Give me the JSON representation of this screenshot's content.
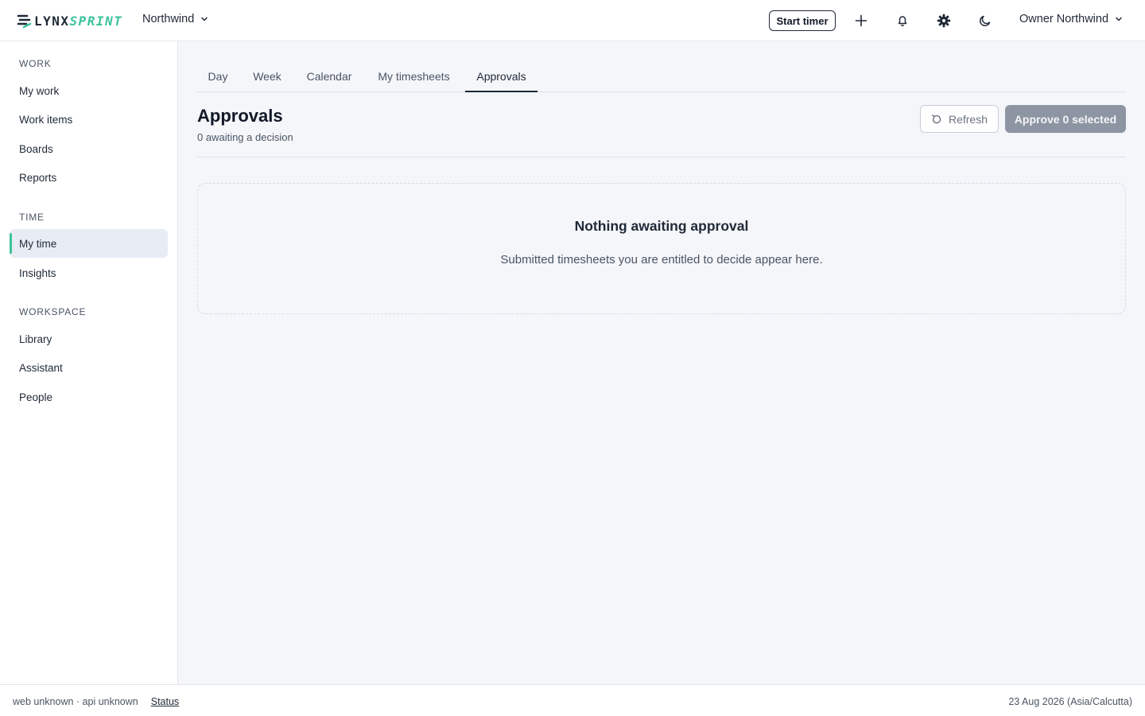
{
  "brand": {
    "name_part1": "LYNX",
    "name_part2": "SPRINT",
    "accent_color": "#3cc39a"
  },
  "header": {
    "org_name": "Northwind",
    "start_timer_label": "Start timer",
    "icons": [
      "plus-icon",
      "bell-icon",
      "gear-icon",
      "moon-icon"
    ],
    "user_name": "Owner Northwind"
  },
  "sidebar": {
    "sections": [
      {
        "label": "WORK",
        "items": [
          "My work",
          "Work items",
          "Boards",
          "Reports"
        ]
      },
      {
        "label": "TIME",
        "items": [
          "My time",
          "Insights"
        ]
      },
      {
        "label": "WORKSPACE",
        "items": [
          "Library",
          "Assistant",
          "People"
        ]
      }
    ],
    "active_item": "My time"
  },
  "tabs": {
    "items": [
      "Day",
      "Week",
      "Calendar",
      "My timesheets",
      "Approvals"
    ],
    "active": "Approvals"
  },
  "page": {
    "title": "Approvals",
    "subtitle": "0 awaiting a decision",
    "refresh_label": "Refresh",
    "approve_label": "Approve 0 selected"
  },
  "empty_state": {
    "title": "Nothing awaiting approval",
    "description": "Submitted timesheets you are entitled to decide appear here."
  },
  "footer": {
    "version_text": "web unknown · api unknown",
    "status_link": "Status",
    "date_text": "23 Aug 2026 (Asia/Calcutta)"
  }
}
